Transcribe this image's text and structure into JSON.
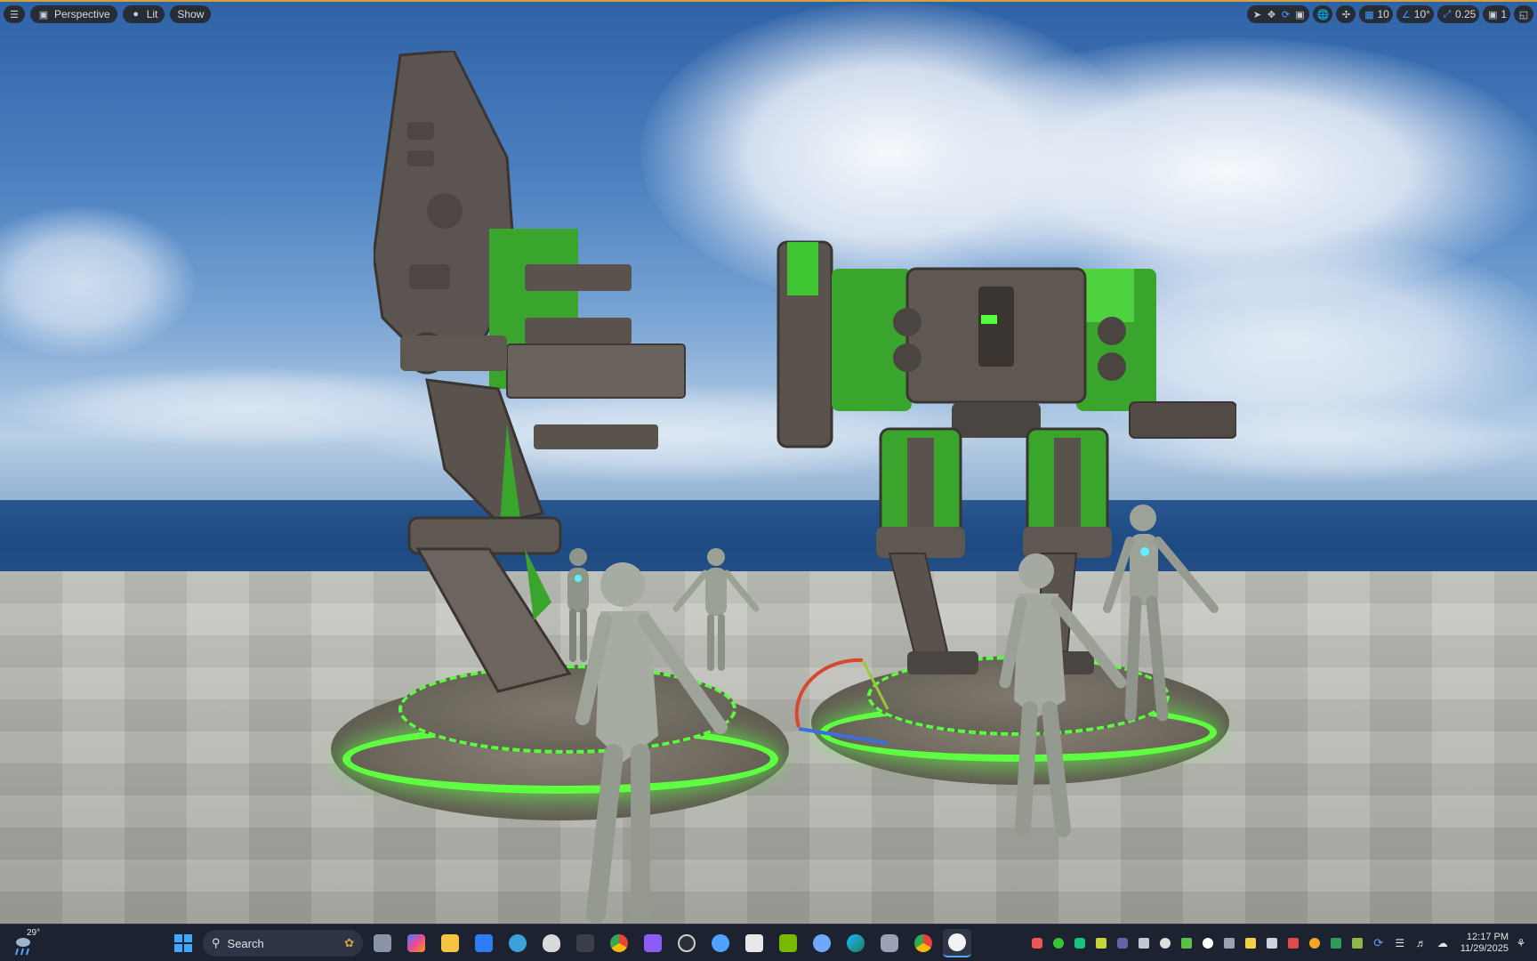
{
  "viewport_toolbar": {
    "view_mode": "Perspective",
    "lighting_mode": "Lit",
    "show_label": "Show",
    "grid_snap_value": "10",
    "rotation_snap_value": "10°",
    "scale_snap_value": "0.25",
    "camera_speed_value": "1"
  },
  "taskbar": {
    "weather_temp": "29°",
    "search_placeholder": "Search",
    "clock_time": "12:17 PM",
    "clock_date": "11/29/2025"
  },
  "icons": {
    "menu": "hamburger-menu-icon",
    "perspective": "cube-icon",
    "lit": "sphere-icon",
    "select": "cursor-icon",
    "move": "move-icon",
    "rotate": "rotate-icon",
    "scale": "scale-icon",
    "world": "globe-icon",
    "surface_snap": "surface-snap-icon",
    "grid": "grid-icon",
    "angle": "angle-icon",
    "scale_snap": "scale-arrow-icon",
    "camera": "camera-icon",
    "maximize": "maximize-icon"
  },
  "colors": {
    "accent_blue": "#3d9bff",
    "neon_green": "#4dff3a",
    "viewport_border": "#d6a23c"
  }
}
